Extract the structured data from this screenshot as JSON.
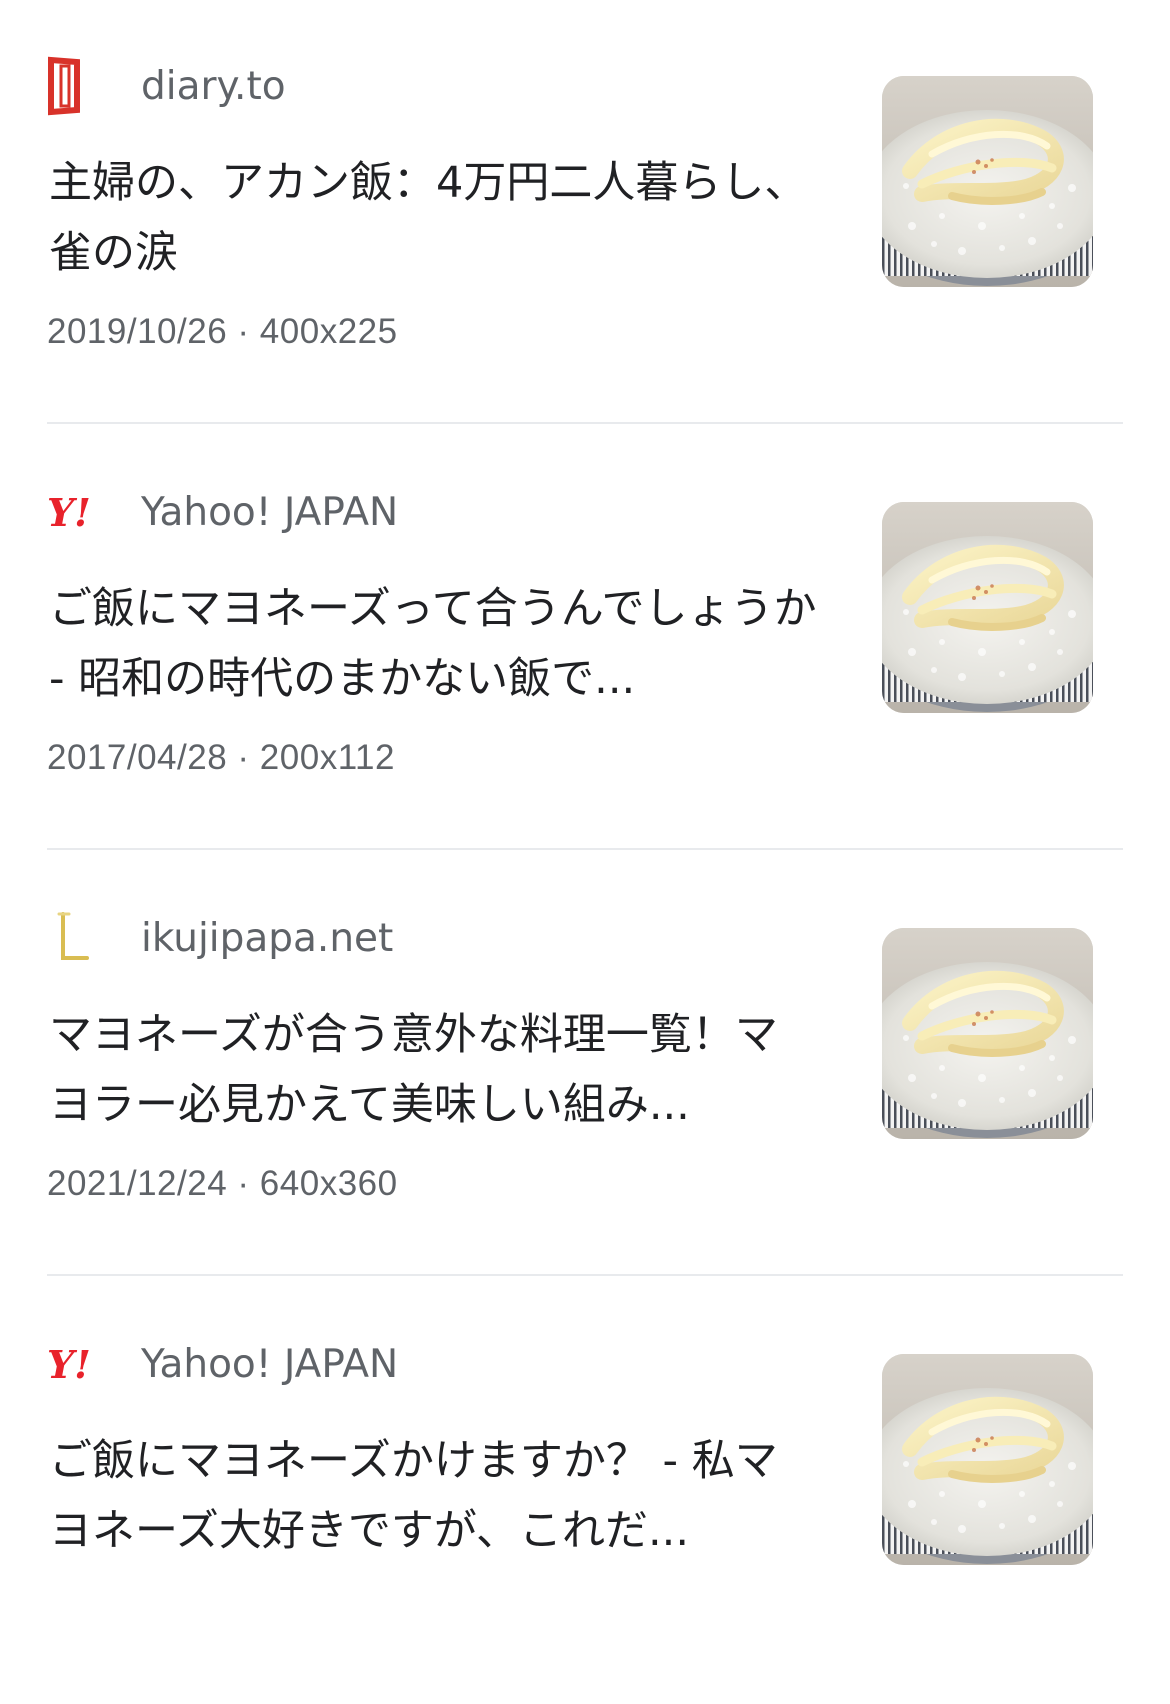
{
  "results": [
    {
      "source": "diary.to",
      "logo_icon": "diary-logo-icon",
      "title": "主婦の、アカン飯：4万円二人暮らし、雀の涙",
      "date": "2019/10/26",
      "size": "400x225",
      "separator": "·",
      "thumbnail_icon": "rice-with-mayonnaise-thumbnail"
    },
    {
      "source": "Yahoo! JAPAN",
      "logo_icon": "yahoo-logo-icon",
      "title": "ご飯にマヨネーズって合うんでしょうか - 昭和の時代のまかない飯で...",
      "date": "2017/04/28",
      "size": "200x112",
      "separator": "·",
      "thumbnail_icon": "rice-with-mayonnaise-thumbnail"
    },
    {
      "source": "ikujipapa.net",
      "logo_icon": "ikujipapa-logo-icon",
      "title": "マヨネーズが合う意外な料理一覧！マヨラー必見かえて美味しい組み...",
      "date": "2021/12/24",
      "size": "640x360",
      "separator": "·",
      "thumbnail_icon": "rice-with-mayonnaise-thumbnail"
    },
    {
      "source": "Yahoo! JAPAN",
      "logo_icon": "yahoo-logo-icon",
      "title": "ご飯にマヨネーズかけますか？ - 私マヨネーズ大好きですが、これだ...",
      "date": "",
      "size": "",
      "separator": "",
      "thumbnail_icon": "rice-with-mayonnaise-thumbnail"
    }
  ],
  "colors": {
    "source_text": "#5f6368",
    "title_text": "#202124",
    "divider": "#e8eaed",
    "diary_red": "#d8322a",
    "yahoo_red": "#e8222b",
    "ikujipapa_gold": "#d9bd52"
  }
}
